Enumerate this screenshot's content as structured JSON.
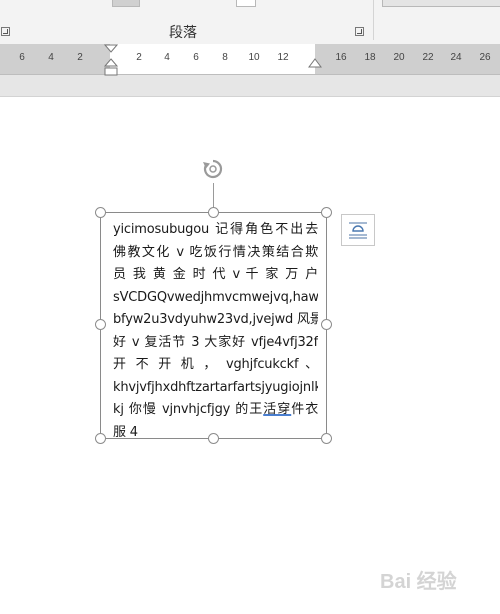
{
  "ribbon": {
    "group_label": "段落"
  },
  "ruler": {
    "ticks": [
      "6",
      "4",
      "2",
      "2",
      "4",
      "6",
      "8",
      "10",
      "12",
      "16",
      "18",
      "20",
      "22",
      "24",
      "26"
    ]
  },
  "textbox": {
    "lines": [
      "yicimosubugou 记得角色不出去",
      "佛教文化 v 吃饭行情决策结合欺",
      "员 我 黄 金 时 代  v  千 家 万 户",
      "sVCDGQvwedjhmvcmwejvq,hawe",
      "bfyw2u3vdyuhw23vd,jvejwd 风景",
      "好 v 复活节 3 大家好 vfje4vfj32f",
      "开  不  开  机  ，  vghjfcukckf  、",
      "khvjvfjhxdhftzartarfartsjyugiojnlkb",
      "kj 你慢 vjnvhjcfjgy 的王",
      "服 4"
    ],
    "line9_underlined": "活穿",
    "line9_tail": "件衣"
  },
  "watermark": {
    "text": "Bai 经验"
  }
}
